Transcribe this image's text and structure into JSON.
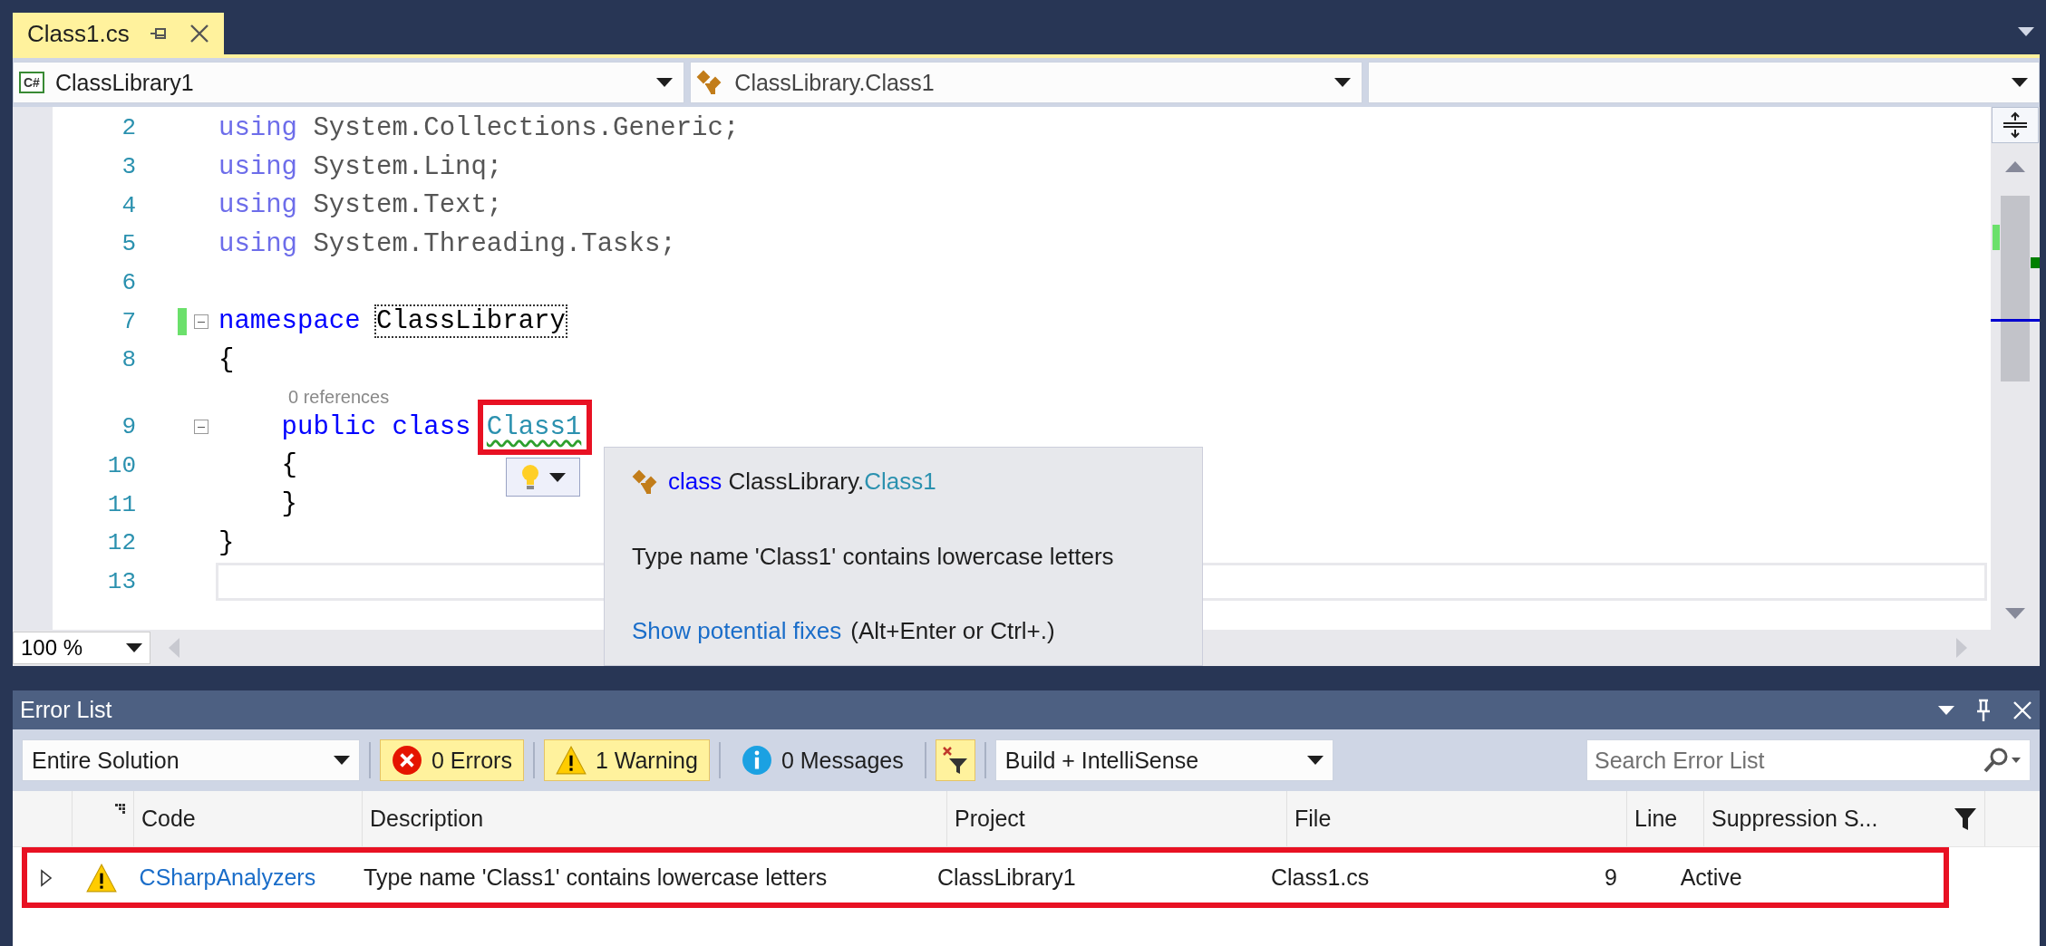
{
  "document_tabs": [
    {
      "label": "Class1.cs",
      "selected": true
    }
  ],
  "nav_bar": {
    "project_badge": "C#",
    "project": "ClassLibrary1",
    "type": "ClassLibrary.Class1"
  },
  "editor": {
    "lines": [
      {
        "number": "2",
        "changed": false,
        "fold": false,
        "current": false,
        "tokens": [
          {
            "kind": "dim-keyword",
            "text": "using"
          },
          {
            "kind": "dim",
            "text": " System.Collections.Generic;"
          }
        ]
      },
      {
        "number": "3",
        "changed": false,
        "fold": false,
        "current": false,
        "tokens": [
          {
            "kind": "dim-keyword",
            "text": "using"
          },
          {
            "kind": "dim",
            "text": " System.Linq;"
          }
        ]
      },
      {
        "number": "4",
        "changed": false,
        "fold": false,
        "current": false,
        "tokens": [
          {
            "kind": "dim-keyword",
            "text": "using"
          },
          {
            "kind": "dim",
            "text": " System.Text;"
          }
        ]
      },
      {
        "number": "5",
        "changed": false,
        "fold": false,
        "current": false,
        "tokens": [
          {
            "kind": "dim-keyword",
            "text": "using"
          },
          {
            "kind": "dim",
            "text": " System.Threading.Tasks;"
          }
        ]
      },
      {
        "number": "6",
        "changed": false,
        "fold": false,
        "current": false
      },
      {
        "number": "7",
        "changed": true,
        "fold": true,
        "current": false,
        "tokens": [
          {
            "kind": "keyword",
            "text": "namespace "
          },
          {
            "kind": "boxed",
            "text": "ClassLibrary"
          }
        ]
      },
      {
        "number": "8",
        "changed": false,
        "fold": false,
        "current": false,
        "tokens": [
          {
            "kind": "plain",
            "text": "{"
          }
        ]
      },
      {
        "number": "9",
        "changed": false,
        "fold": true,
        "current": false,
        "codelens": "0 references",
        "tokens": [
          {
            "kind": "keyword",
            "text": "    public class "
          },
          {
            "kind": "warning-type",
            "text": "Class1",
            "framed": true
          }
        ]
      },
      {
        "number": "10",
        "changed": false,
        "fold": false,
        "current": false,
        "tokens": [
          {
            "kind": "plain",
            "text": "    {"
          }
        ]
      },
      {
        "number": "11",
        "changed": false,
        "fold": false,
        "current": false,
        "tokens": [
          {
            "kind": "plain",
            "text": "    }"
          }
        ]
      },
      {
        "number": "12",
        "changed": false,
        "fold": false,
        "current": false,
        "tokens": [
          {
            "kind": "plain",
            "text": "}"
          }
        ]
      },
      {
        "number": "13",
        "changed": false,
        "fold": false,
        "current": true
      }
    ],
    "zoom": "100 %",
    "quick_info": {
      "keyword": "class",
      "namespace": "ClassLibrary.",
      "type_name": "Class1",
      "message": "Type name 'Class1' contains lowercase letters",
      "link": "Show potential fixes",
      "shortcut": "(Alt+Enter or Ctrl+.)"
    }
  },
  "error_list": {
    "title": "Error List",
    "scope": "Entire Solution",
    "filters": [
      {
        "kind": "error",
        "label": "0 Errors",
        "selected": true
      },
      {
        "kind": "warning",
        "label": "1 Warning",
        "selected": true
      },
      {
        "kind": "message",
        "label": "0 Messages",
        "selected": false
      }
    ],
    "filter_toggle": {
      "selected": true
    },
    "source": "Build + IntelliSense",
    "search": {
      "placeholder": "Search Error List"
    },
    "columns": [
      "Code",
      "Description",
      "Project",
      "File",
      "Line",
      "Suppression S..."
    ],
    "rows": [
      {
        "kind": "warning",
        "expanded": false,
        "framed": true,
        "cells": [
          "CSharpAnalyzers",
          "Type name 'Class1' contains lowercase letters",
          "ClassLibrary1",
          "Class1.cs",
          "9",
          "Active"
        ]
      }
    ]
  }
}
